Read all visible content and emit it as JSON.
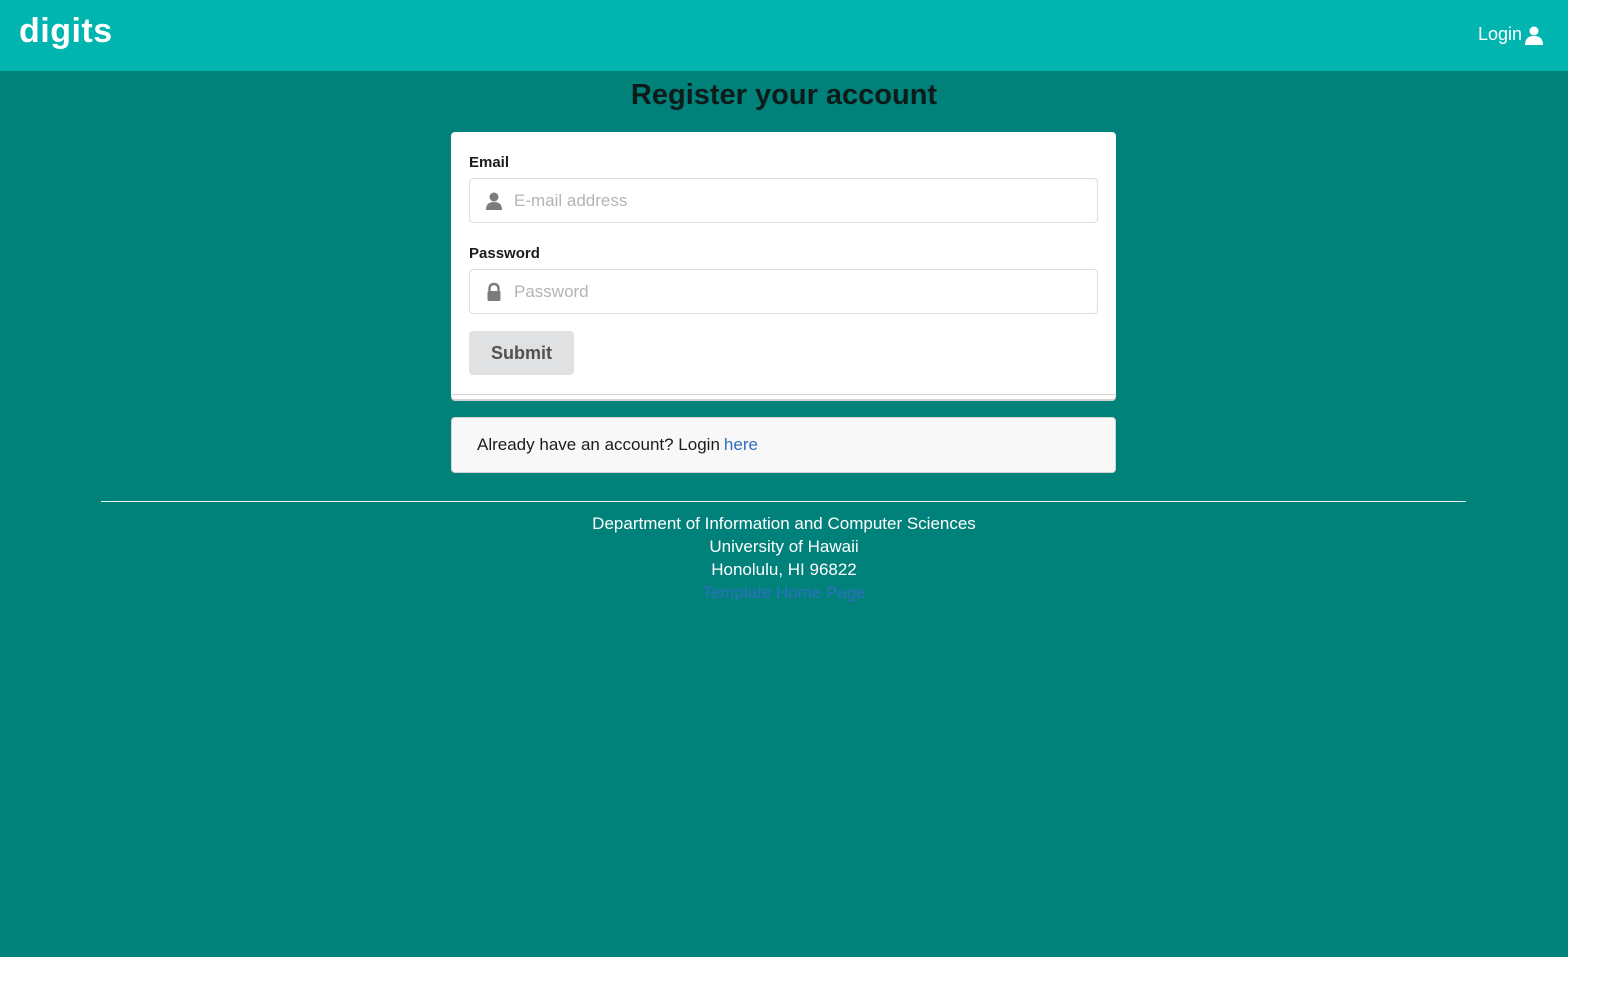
{
  "navbar": {
    "brand": "digits",
    "login_label": "Login",
    "login_icon": "user-icon"
  },
  "page_title": "Register your account",
  "form": {
    "email_label": "Email",
    "email_placeholder": "E-mail address",
    "email_value": "",
    "email_icon": "user-icon",
    "password_label": "Password",
    "password_placeholder": "Password",
    "password_value": "",
    "password_icon": "lock-icon",
    "submit_label": "Submit"
  },
  "login_prompt": {
    "text": "Already have an account? Login",
    "link_label": "here"
  },
  "footer": {
    "line1": "Department of Information and Computer Sciences",
    "line2": "University of Hawaii",
    "line3": "Honolulu, HI 96822",
    "link_label": "Template Home Page"
  },
  "colors": {
    "navbar_bg": "#00b5b0",
    "page_bg": "#00827b",
    "link": "#2f6fc0",
    "submit_bg": "#e0e1e2"
  }
}
